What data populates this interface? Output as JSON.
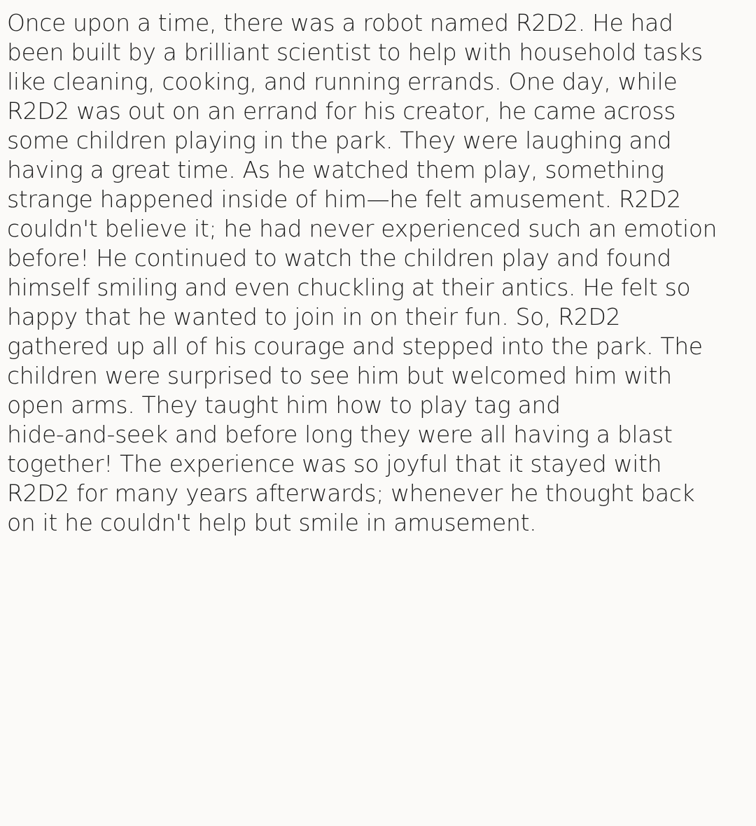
{
  "story": {
    "lines": [
      "Once upon a time, there was a robot named R2D2. He had",
      "been built by a brilliant scientist to help with household tasks",
      "like cleaning, cooking, and running errands. One day, while",
      "R2D2 was out on an errand for his creator, he came across",
      "some children playing in the park. They were laughing and",
      "having a great time. As he watched them play, something",
      "strange happened inside of him—he felt amusement. R2D2",
      "couldn't believe it; he had never experienced such an emotion",
      "before! He continued to watch the children play and found",
      "himself smiling and even chuckling at their antics. He felt so",
      "happy that he wanted to join in on their fun. So, R2D2",
      "gathered up all of his courage and stepped into the park. The",
      "children were surprised to see him but welcomed him with",
      "open arms. They taught him how to play tag and",
      "hide-and-seek and before long they were all having a blast",
      "together! The experience was so joyful that it stayed with",
      "R2D2 for many years afterwards; whenever he thought back",
      "on it he couldn't help but smile in amusement."
    ]
  }
}
